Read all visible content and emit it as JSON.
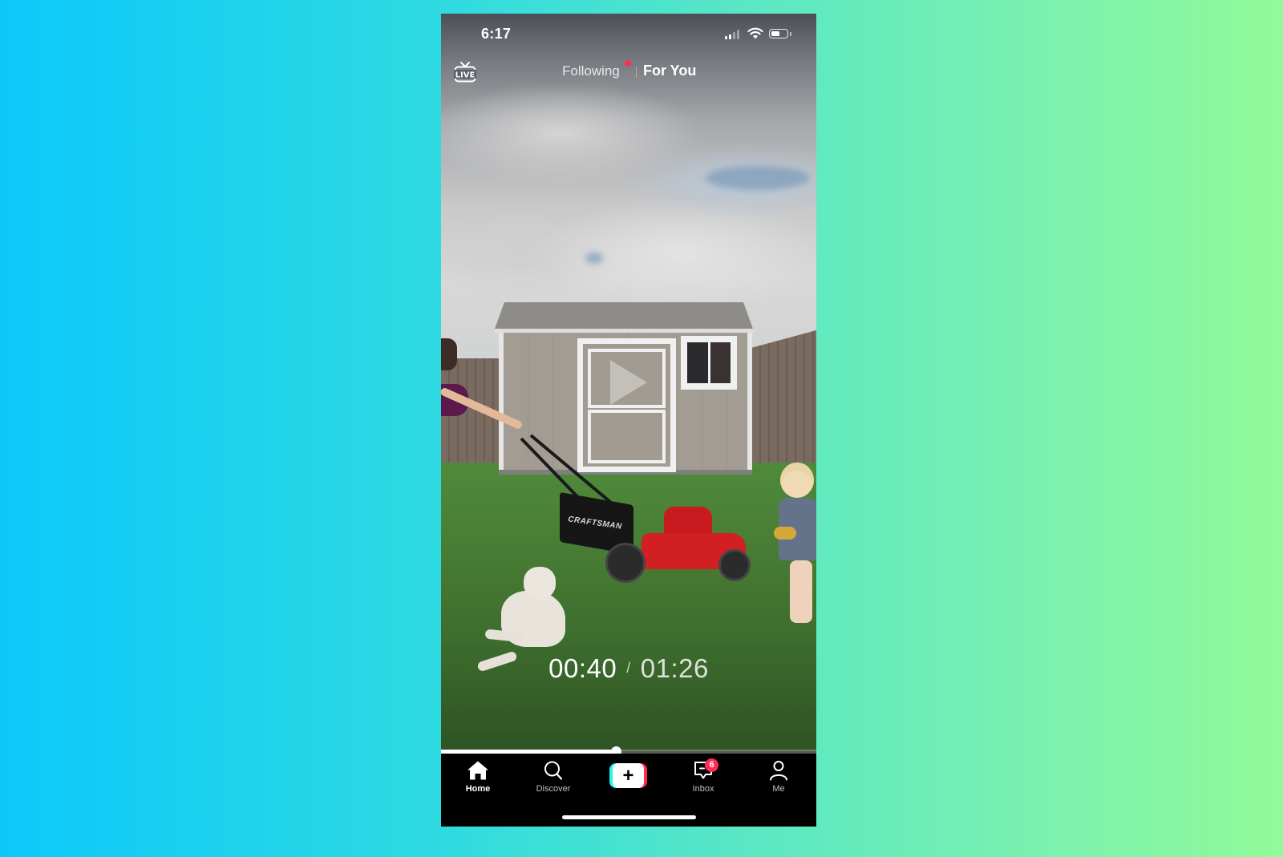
{
  "status_bar": {
    "time": "6:17",
    "signal_bars": 2,
    "signal_bars_total": 4,
    "battery_level": 0.6
  },
  "top_nav": {
    "live_icon": "live-tv-icon",
    "live_label": "LIVE",
    "tabs": [
      {
        "label": "Following",
        "active": false,
        "has_notification_dot": true
      },
      {
        "label": "For You",
        "active": true
      }
    ]
  },
  "video": {
    "state": "paused",
    "brand_text": "CRAFTSMAN",
    "current_time": "00:40",
    "separator": "/",
    "total_time": "01:26",
    "progress": 0.465
  },
  "tabbar": {
    "items": [
      {
        "label": "Home",
        "icon": "home-icon",
        "active": true
      },
      {
        "label": "Discover",
        "icon": "search-icon",
        "active": false
      },
      {
        "label": "",
        "icon": "plus-icon",
        "create_glyph": "+"
      },
      {
        "label": "Inbox",
        "icon": "inbox-icon",
        "badge": "6"
      },
      {
        "label": "Me",
        "icon": "profile-icon",
        "active": false
      }
    ]
  },
  "colors": {
    "accent_pink": "#fe2c55",
    "accent_cyan": "#25f4ee",
    "background_gradient_start": "#0cc8fb",
    "background_gradient_end": "#92fa98"
  }
}
